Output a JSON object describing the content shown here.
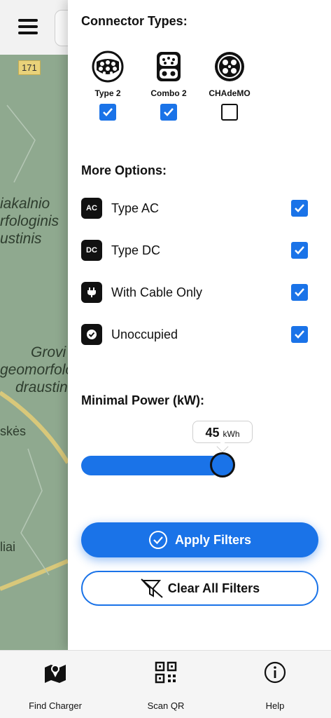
{
  "map": {
    "road_badge": "171",
    "labels": [
      "iakalnio",
      "rfologinis",
      "ustinis",
      "Grovi",
      "geomorfolo",
      "draustin",
      "skės",
      "liai"
    ]
  },
  "filters": {
    "connector_title": "Connector Types:",
    "connectors": [
      {
        "label": "Type 2",
        "checked": true
      },
      {
        "label": "Combo 2",
        "checked": true
      },
      {
        "label": "CHAdeMO",
        "checked": false
      }
    ],
    "more_title": "More Options:",
    "options": [
      {
        "icon": "AC",
        "label": "Type AC",
        "checked": true
      },
      {
        "icon": "DC",
        "label": "Type DC",
        "checked": true
      },
      {
        "icon": "plug-icon",
        "label": "With Cable Only",
        "checked": true
      },
      {
        "icon": "check-circle-icon",
        "label": "Unoccupied",
        "checked": true
      }
    ],
    "power_title": "Minimal Power (kW):",
    "power_value": "45",
    "power_unit": "kWh",
    "apply_label": "Apply Filters",
    "clear_label": "Clear All Filters"
  },
  "colors": {
    "accent": "#1a73e8",
    "dark": "#111111"
  },
  "nav": {
    "items": [
      {
        "label": "Find Charger",
        "icon": "map-pin-icon"
      },
      {
        "label": "Scan QR",
        "icon": "qr-code-icon"
      },
      {
        "label": "Help",
        "icon": "info-icon"
      }
    ]
  }
}
